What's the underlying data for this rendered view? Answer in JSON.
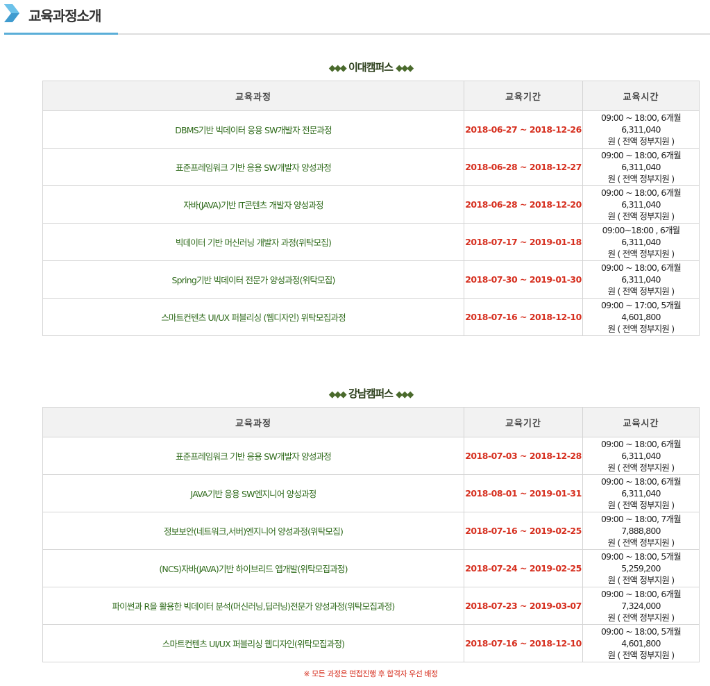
{
  "header": {
    "title": "교육과정소개",
    "accent_color": "#5aaed8"
  },
  "campuses": [
    {
      "title": "이대캠퍼스",
      "decor_left": "◆◆◆",
      "decor_right": "◆◆◆",
      "columns": [
        "교육과정",
        "교육기간",
        "교육시간"
      ],
      "rows": [
        {
          "name": "DBMS기반 빅데이터 응용 SW개발자 전문과정",
          "period": "2018-06-27 ~ 2018-12-26",
          "time_line1": "09:00 ~ 18:00, 6개월 6,311,040",
          "time_line2": "원 ( 전액 정부지원 )"
        },
        {
          "name": "표준프레임워크 기반 응용 SW개발자 양성과정",
          "period": "2018-06-28 ~ 2018-12-27",
          "time_line1": "09:00 ~ 18:00, 6개월 6,311,040",
          "time_line2": "원 ( 전액 정부지원 )"
        },
        {
          "name": "자바(JAVA)기반 IT콘텐츠 개발자 양성과정",
          "period": "2018-06-28 ~ 2018-12-20",
          "time_line1": "09:00 ~ 18:00, 6개월 6,311,040",
          "time_line2": "원 ( 전액 정부지원 )"
        },
        {
          "name": "빅데이터 기반 머신러닝 개발자 과정(위탁모집)",
          "period": "2018-07-17 ~ 2019-01-18",
          "time_line1": "09:00~18:00 , 6개월 6,311,040",
          "time_line2": "원 ( 전액 정부지원 )"
        },
        {
          "name": "Spring기반 빅데이터 전문가 양성과정(위탁모집)",
          "period": "2018-07-30 ~ 2019-01-30",
          "time_line1": "09:00 ~ 18:00, 6개월 6,311,040",
          "time_line2": "원 ( 전액 정부지원 )"
        },
        {
          "name": "스마트컨텐츠 UI/UX 퍼블리싱 (웹디자인) 위탁모집과정",
          "period": "2018-07-16 ~ 2018-12-10",
          "time_line1": "09:00 ~ 17:00, 5개월 4,601,800",
          "time_line2": "원 ( 전액 정부지원 )"
        }
      ]
    },
    {
      "title": "강남캠퍼스",
      "decor_left": "◆◆◆",
      "decor_right": "◆◆◆",
      "columns": [
        "교육과정",
        "교육기간",
        "교육시간"
      ],
      "rows": [
        {
          "name": "표준프레임워크 기반 응용 SW개발자 양성과정",
          "period": "2018-07-03 ~ 2018-12-28",
          "time_line1": "09:00 ~ 18:00, 6개월 6,311,040",
          "time_line2": "원 ( 전액 정부지원 )"
        },
        {
          "name": "JAVA기반 응용 SW엔지니어 양성과정",
          "period": "2018-08-01 ~ 2019-01-31",
          "time_line1": "09:00 ~ 18:00, 6개월 6,311,040",
          "time_line2": "원 ( 전액 정부지원 )"
        },
        {
          "name": "정보보안(네트워크,서버)엔지니어 양성과정(위탁모집)",
          "period": "2018-07-16 ~ 2019-02-25",
          "time_line1": "09:00 ~ 18:00, 7개월 7,888,800",
          "time_line2": "원 ( 전액 정부지원 )"
        },
        {
          "name": "(NCS)자바(JAVA)기반 하이브리드 앱개발(위탁모집과정)",
          "period": "2018-07-24 ~ 2019-02-25",
          "time_line1": "09:00 ~ 18:00, 5개월 5,259,200",
          "time_line2": "원 ( 전액 정부지원 )"
        },
        {
          "name": "파이썬과 R을 활용한 빅데이터 분석(머신러닝,딥러닝)전문가 양성과정(위탁모집과정)",
          "period": "2018-07-23 ~ 2019-03-07",
          "time_line1": "09:00 ~ 18:00, 6개월 7,324,000",
          "time_line2": "원 ( 전액 정부지원 )"
        },
        {
          "name": "스마트컨텐츠 UI/UX 퍼블리싱 웹디자인(위탁모집과정)",
          "period": "2018-07-16 ~ 2018-12-10",
          "time_line1": "09:00 ~ 18:00, 5개월 4,601,800",
          "time_line2": "원 ( 전액 정부지원 )"
        }
      ]
    }
  ],
  "footer": {
    "note": "※ 모든 과정은 면접진행 후 합격자 우선 배정"
  },
  "colors": {
    "course_name": "#2e6a1a",
    "period": "#d62f1f",
    "header_bg": "#f2f2f2"
  }
}
